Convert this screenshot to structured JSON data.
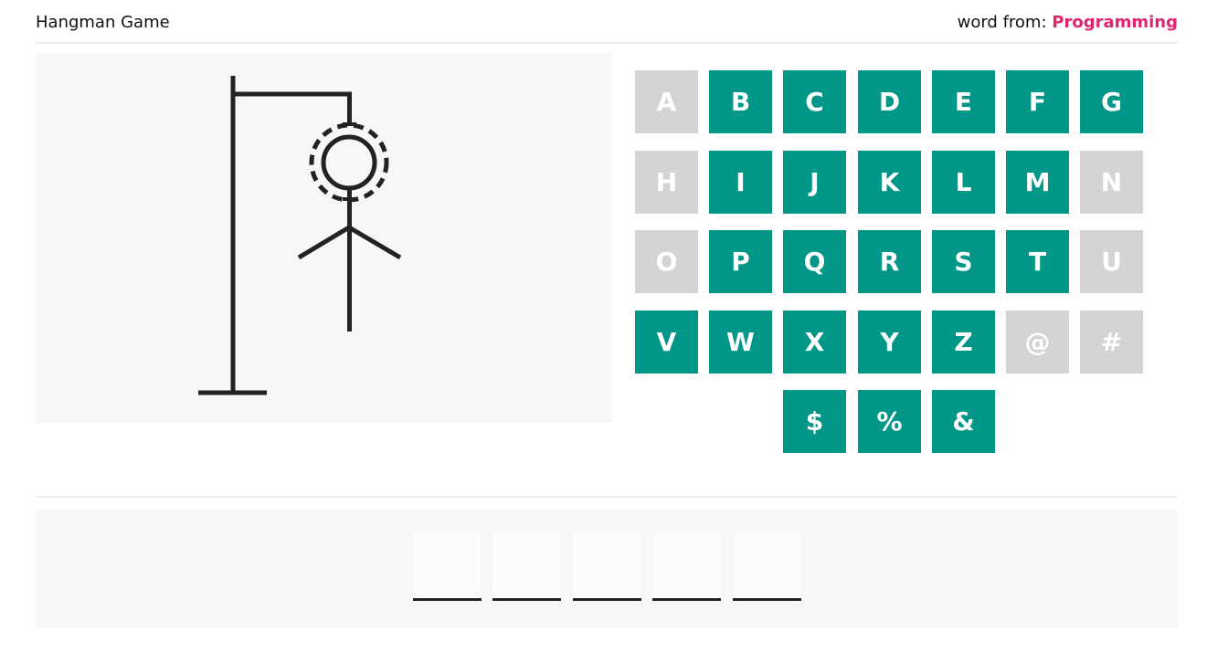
{
  "header": {
    "title": "Hangman Game",
    "word_from_label": "word from:",
    "category": "Programming"
  },
  "colors": {
    "key_available": "#009688",
    "key_used": "#d4d4d4",
    "category": "#e0246f",
    "panel_bg": "#f7f7f7",
    "stroke": "#222222"
  },
  "gallows": {
    "visible_parts": [
      "base",
      "pole",
      "beam",
      "rope",
      "head",
      "body",
      "left-arm",
      "right-arm"
    ],
    "head_highlighted": true
  },
  "keyboard": {
    "rows": [
      [
        {
          "label": "A",
          "used": true
        },
        {
          "label": "B",
          "used": false
        },
        {
          "label": "C",
          "used": false
        },
        {
          "label": "D",
          "used": false
        },
        {
          "label": "E",
          "used": false
        },
        {
          "label": "F",
          "used": false
        },
        {
          "label": "G",
          "used": false
        }
      ],
      [
        {
          "label": "H",
          "used": true
        },
        {
          "label": "I",
          "used": false
        },
        {
          "label": "J",
          "used": false
        },
        {
          "label": "K",
          "used": false
        },
        {
          "label": "L",
          "used": false
        },
        {
          "label": "M",
          "used": false
        },
        {
          "label": "N",
          "used": true
        }
      ],
      [
        {
          "label": "O",
          "used": true
        },
        {
          "label": "P",
          "used": false
        },
        {
          "label": "Q",
          "used": false
        },
        {
          "label": "R",
          "used": false
        },
        {
          "label": "S",
          "used": false
        },
        {
          "label": "T",
          "used": false
        },
        {
          "label": "U",
          "used": true
        }
      ],
      [
        {
          "label": "V",
          "used": false
        },
        {
          "label": "W",
          "used": false
        },
        {
          "label": "X",
          "used": false
        },
        {
          "label": "Y",
          "used": false
        },
        {
          "label": "Z",
          "used": false
        },
        {
          "label": "@",
          "used": true
        },
        {
          "label": "#",
          "used": true
        }
      ],
      [
        {
          "label": "$",
          "used": false
        },
        {
          "label": "%",
          "used": false
        },
        {
          "label": "&",
          "used": false
        }
      ]
    ]
  },
  "word": {
    "letters": [
      "",
      "",
      "",
      "",
      ""
    ]
  }
}
